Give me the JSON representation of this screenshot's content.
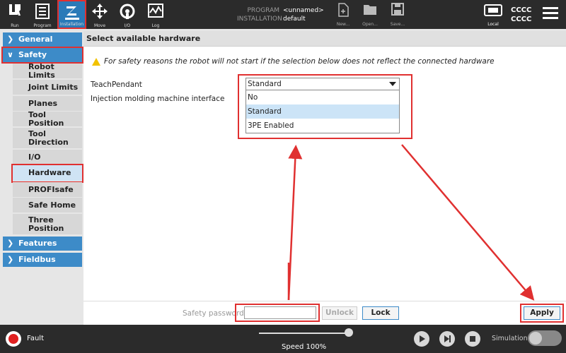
{
  "topbar": {
    "run_label": "Run",
    "program_label": "Program",
    "installation_label": "Installation",
    "move_label": "Move",
    "io_label": "I/O",
    "log_label": "Log",
    "program_key": "PROGRAM",
    "installation_key": "INSTALLATION",
    "program_value": "<unnamed>",
    "installation_value": "default",
    "new_label": "New...",
    "open_label": "Open...",
    "save_label": "Save...",
    "local_label": "Local",
    "cccc_1": "CCCC",
    "cccc_2": "CCCC"
  },
  "sidebar": {
    "general": "General",
    "safety": "Safety",
    "robot_limits": "Robot Limits",
    "joint_limits": "Joint Limits",
    "planes": "Planes",
    "tool_position": "Tool Position",
    "tool_direction": "Tool Direction",
    "io": "I/O",
    "hardware": "Hardware",
    "profisafe": "PROFIsafe",
    "safe_home": "Safe Home",
    "three_position": "Three Position",
    "features": "Features",
    "fieldbus": "Fieldbus"
  },
  "main": {
    "header": "Select available hardware",
    "warning": "For safety reasons the robot will not start if the selection below does not reflect the connected hardware",
    "teachpendant_label": "TeachPendant",
    "imm_label": "Injection molding machine interface",
    "select_value": "Standard",
    "options": [
      "No",
      "Standard",
      "3PE Enabled"
    ]
  },
  "password_bar": {
    "label": "Safety password",
    "unlock": "Unlock",
    "lock": "Lock",
    "apply": "Apply"
  },
  "footer": {
    "fault": "Fault",
    "speed": "Speed 100%",
    "simulation": "Simulation"
  },
  "colors": {
    "accent": "#3d8bc8",
    "highlight": "#e03030",
    "fault": "#e02020"
  }
}
